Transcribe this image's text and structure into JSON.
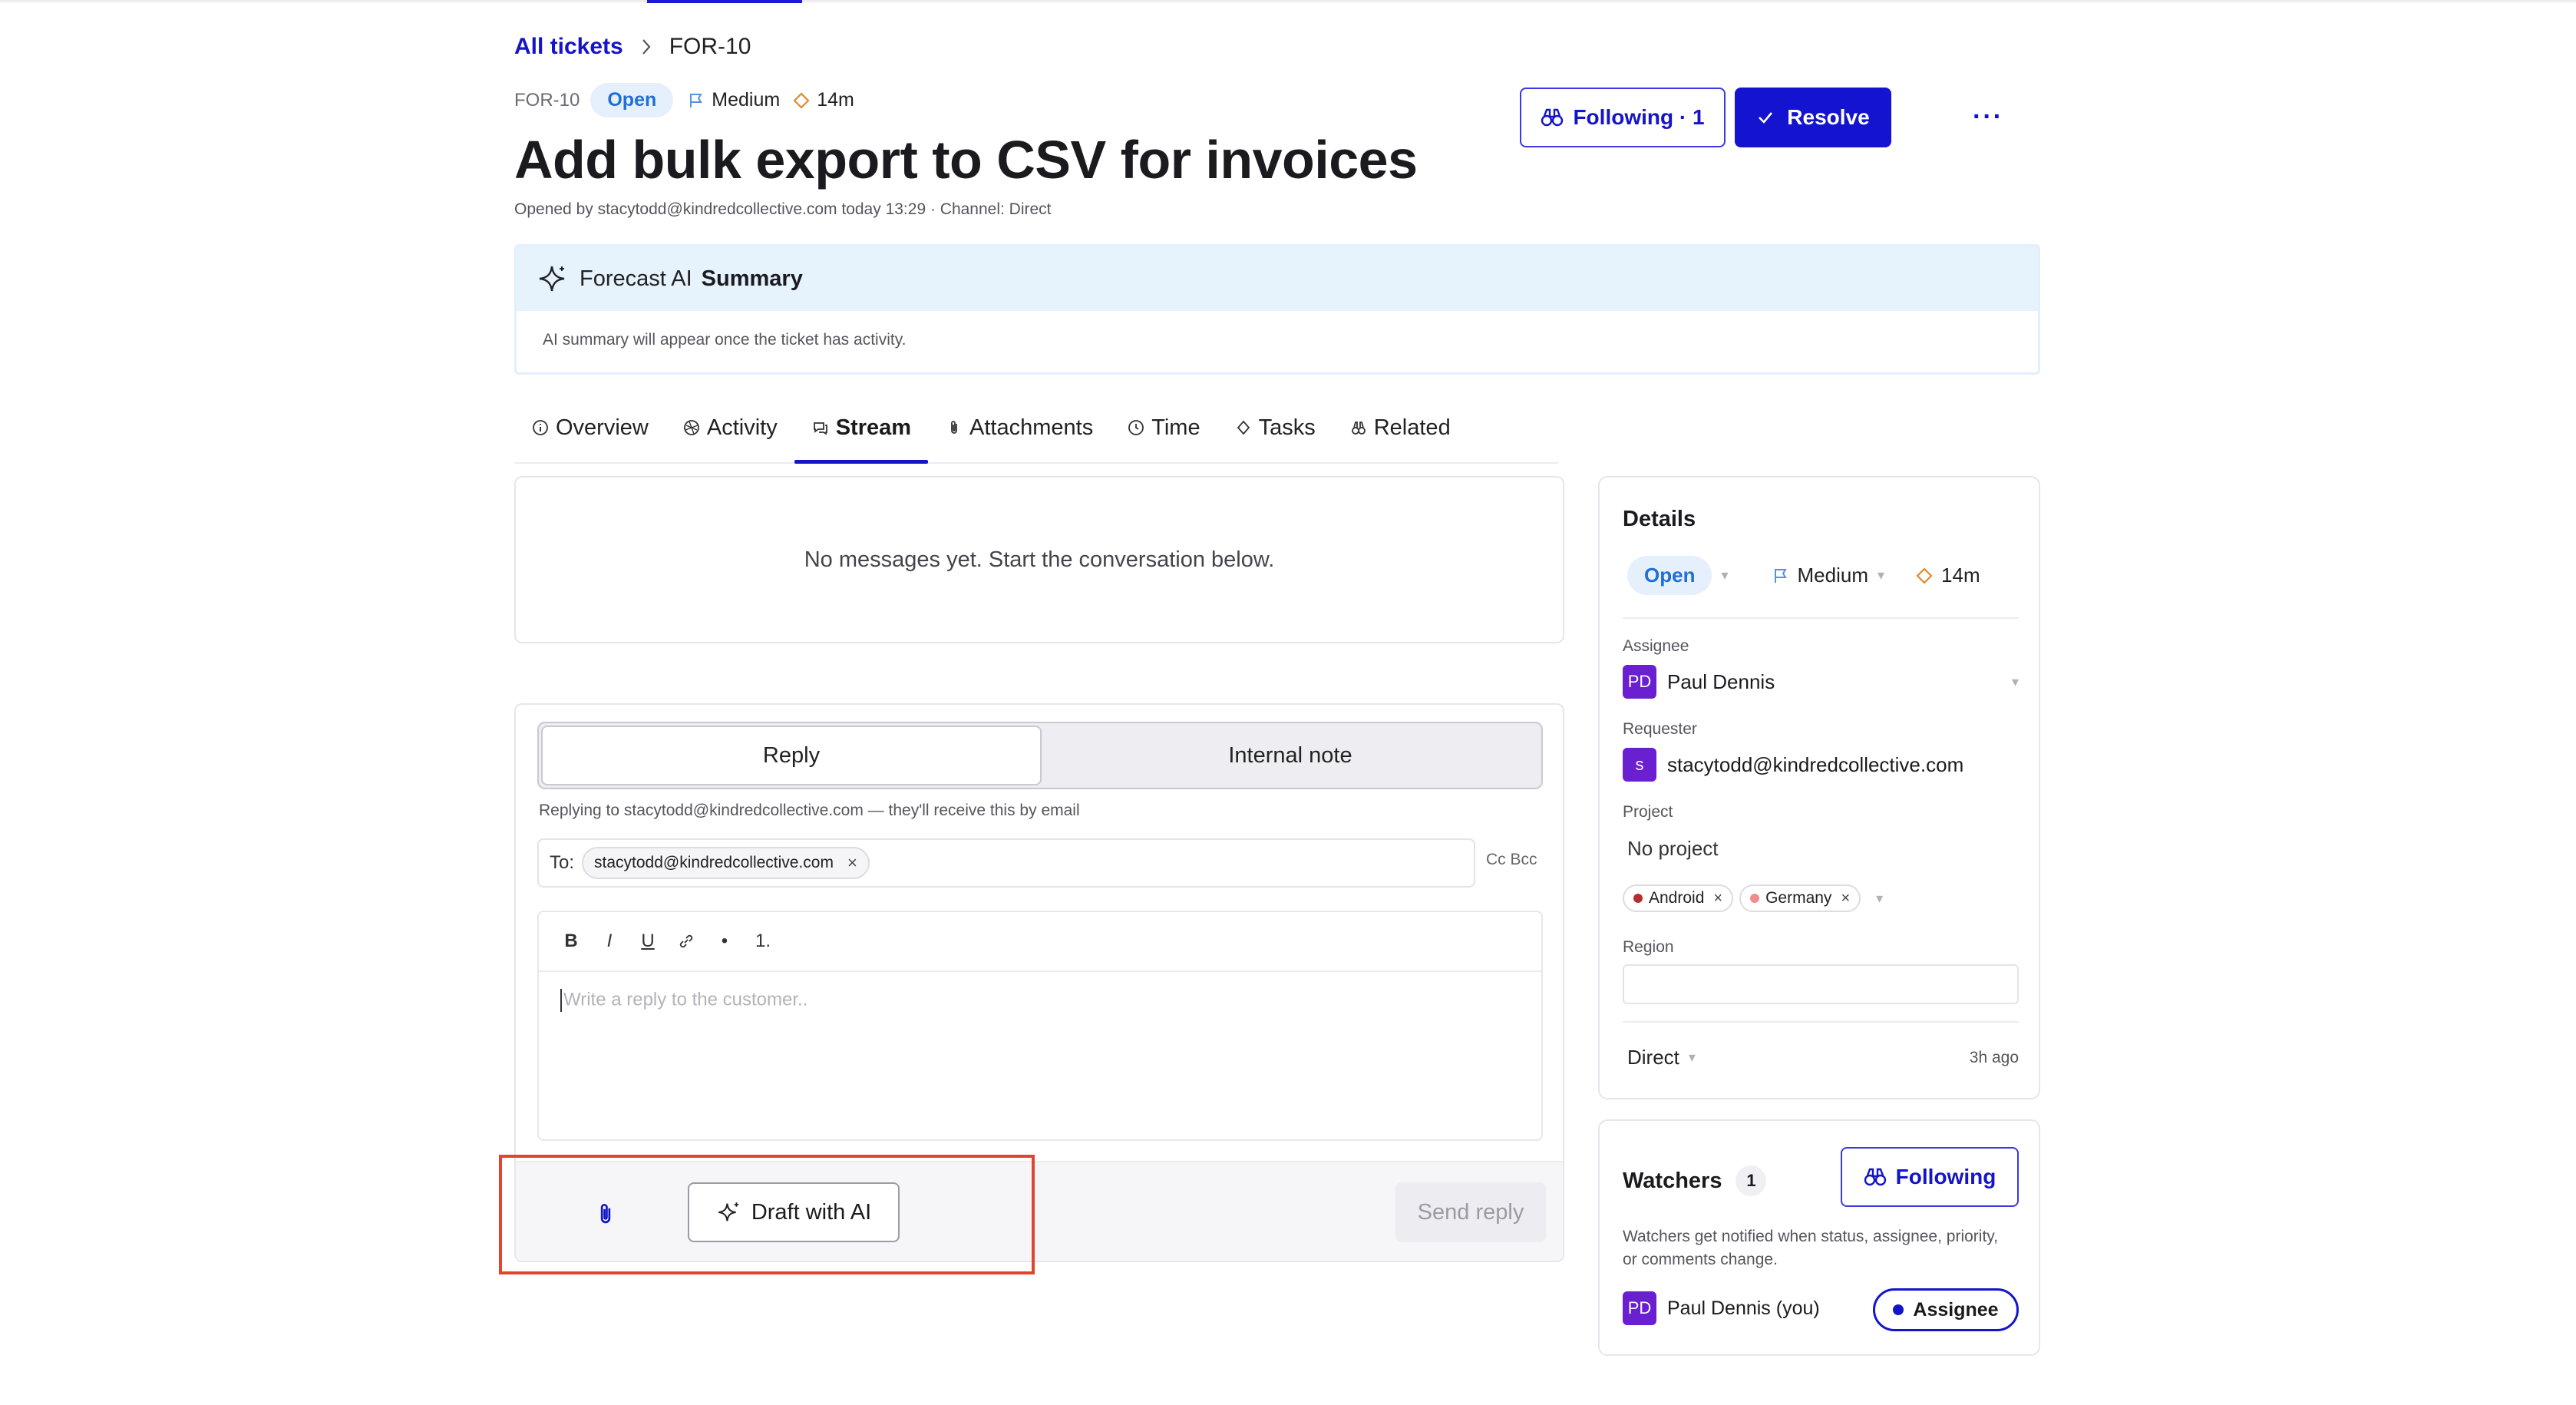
{
  "breadcrumb": {
    "root": "All tickets",
    "current": "FOR-10"
  },
  "ticket": {
    "id": "FOR-10",
    "status": "Open",
    "priority": "Medium",
    "time": "14m",
    "title": "Add bulk export to CSV for invoices",
    "opened_by": "Opened by stacytodd@kindredcollective.com today 13:29 · Channel: Direct"
  },
  "header_actions": {
    "following_label": "Following · 1",
    "resolve_label": "Resolve",
    "more_label": "···"
  },
  "ai_summary": {
    "brand": "Forecast AI",
    "title": "Summary",
    "body": "AI summary will appear once the ticket has activity."
  },
  "tabs": [
    {
      "label": "Overview",
      "icon": "info-icon"
    },
    {
      "label": "Activity",
      "icon": "activity-icon"
    },
    {
      "label": "Stream",
      "icon": "stream-icon",
      "active": true
    },
    {
      "label": "Attachments",
      "icon": "paperclip-icon"
    },
    {
      "label": "Time",
      "icon": "clock-icon"
    },
    {
      "label": "Tasks",
      "icon": "diamond-icon"
    },
    {
      "label": "Related",
      "icon": "link-icon"
    }
  ],
  "messages": {
    "empty_text": "No messages yet. Start the conversation below."
  },
  "composer": {
    "mode_reply": "Reply",
    "mode_internal": "Internal note",
    "replying_to": "Replying to stacytodd@kindredcollective.com — they'll receive this by email",
    "to_label": "To:",
    "to_recipient": "stacytodd@kindredcollective.com",
    "chip_remove": "×",
    "cc_bcc": "Cc Bcc",
    "toolbar": {
      "bold": "B",
      "italic": "I",
      "underline": "U",
      "bullet": "•",
      "numbered": "1."
    },
    "placeholder": "Write a reply to the customer..",
    "draft_ai_label": "Draft with AI",
    "send_label": "Send reply"
  },
  "details": {
    "title": "Details",
    "status": "Open",
    "priority": "Medium",
    "time": "14m",
    "assignee_label": "Assignee",
    "assignee_initials": "PD",
    "assignee_name": "Paul Dennis",
    "requester_label": "Requester",
    "requester_initial": "s",
    "requester_email": "stacytodd@kindredcollective.com",
    "project_label": "Project",
    "project_value": "No project",
    "tags": [
      {
        "label": "Android",
        "color": "#b4302e"
      },
      {
        "label": "Germany",
        "color": "#f08c8c"
      }
    ],
    "region_label": "Region",
    "channel": "Direct",
    "updated": "3h ago"
  },
  "watchers": {
    "title": "Watchers",
    "count": "1",
    "following_label": "Following",
    "description": "Watchers get notified when status, assignee, priority, or comments change.",
    "person_initials": "PD",
    "person_name": "Paul Dennis (you)",
    "role_badge": "Assignee"
  },
  "colors": {
    "accent": "#1414c8",
    "status_blue": "#1f6fd6",
    "avatar": "#6a1fd1",
    "highlight": "#e0452e",
    "time_orange": "#e08a2b"
  }
}
